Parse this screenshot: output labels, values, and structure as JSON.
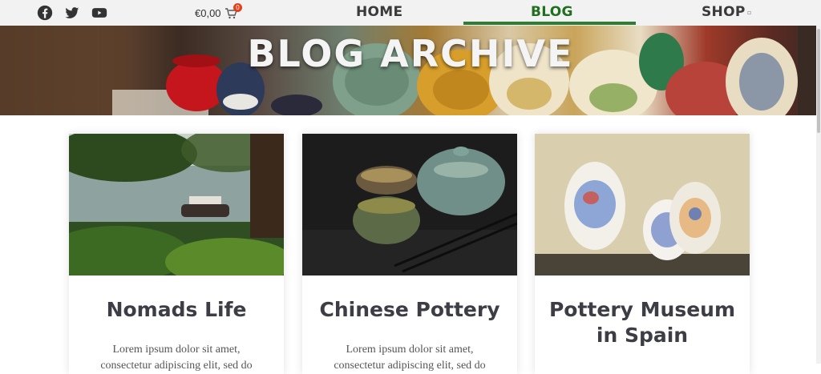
{
  "social": [
    {
      "icon": "facebook-icon"
    },
    {
      "icon": "twitter-icon"
    },
    {
      "icon": "youtube-icon"
    }
  ],
  "cart": {
    "total": "€0,00",
    "count": "0",
    "icon": "cart-icon"
  },
  "nav": {
    "home": "HOME",
    "blog": "BLOG",
    "shop": "SHOP",
    "active": "BLOG",
    "accent_color": "#2e7d32"
  },
  "hero": {
    "title": "BLOG ARCHIVE"
  },
  "posts": [
    {
      "title": "Nomads Life",
      "excerpt": "Lorem ipsum dolor sit amet, consectetur adipiscing elit, sed do"
    },
    {
      "title": "Chinese Pottery",
      "excerpt": "Lorem ipsum dolor sit amet, consectetur adipiscing elit, sed do"
    },
    {
      "title": "Pottery Museum in Spain",
      "excerpt": ""
    }
  ]
}
